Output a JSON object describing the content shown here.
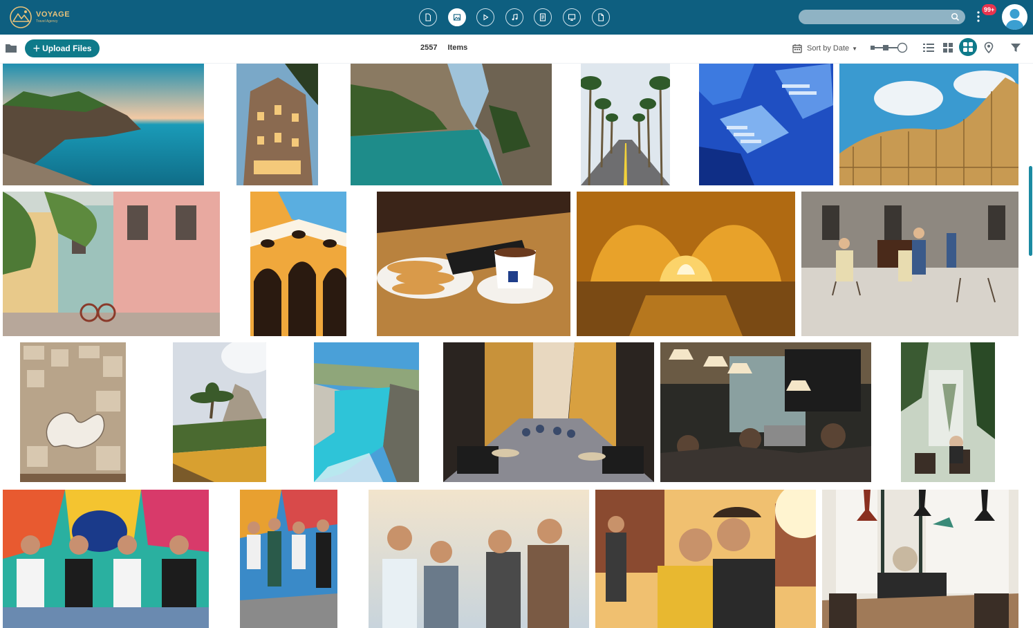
{
  "header": {
    "brand": {
      "name": "VOYAGE",
      "tagline": "Travel Agency"
    },
    "type_tabs": [
      {
        "name": "documents",
        "icon": "document-icon"
      },
      {
        "name": "images",
        "icon": "image-icon",
        "active": true
      },
      {
        "name": "videos",
        "icon": "play-icon"
      },
      {
        "name": "audio",
        "icon": "music-note-icon"
      },
      {
        "name": "text",
        "icon": "text-file-icon"
      },
      {
        "name": "presentations",
        "icon": "presentation-icon"
      },
      {
        "name": "other",
        "icon": "file-icon"
      }
    ],
    "search": {
      "placeholder": "",
      "icon": "search-icon"
    },
    "notifications": {
      "badge": "99+"
    },
    "colors": {
      "bar": "#0e5f80",
      "badge": "#e8344e"
    }
  },
  "toolbar": {
    "upload_label": "Upload Files",
    "item_count": "2557",
    "items_label": "Items",
    "sort_label": "Sort by Date",
    "views": [
      "list-view-icon",
      "grid-view-icon",
      "mosaic-view-icon",
      "map-pin-icon",
      "filter-icon"
    ],
    "active_view": "mosaic-view-icon",
    "accent": "#0e7a8a"
  },
  "gallery": {
    "photos": [
      {
        "name": "photo-coastal-cliffs"
      },
      {
        "name": "photo-casa-batllo"
      },
      {
        "name": "photo-river-canyon"
      },
      {
        "name": "photo-palm-boulevard"
      },
      {
        "name": "photo-blue-staircases"
      },
      {
        "name": "photo-metropol-parasol"
      },
      {
        "name": "photo-colorful-street"
      },
      {
        "name": "photo-courtyard-arches"
      },
      {
        "name": "photo-churros-chocolate"
      },
      {
        "name": "photo-golden-arched-baths"
      },
      {
        "name": "photo-street-musicians"
      },
      {
        "name": "photo-aerial-city"
      },
      {
        "name": "photo-palm-terrace"
      },
      {
        "name": "photo-turquoise-cove"
      },
      {
        "name": "photo-busy-cafe-street"
      },
      {
        "name": "photo-coffee-shop-interior"
      },
      {
        "name": "photo-garden-cafe"
      },
      {
        "name": "photo-mural-friends"
      },
      {
        "name": "photo-mural-group"
      },
      {
        "name": "photo-sunset-friends"
      },
      {
        "name": "photo-rooftop-couple"
      },
      {
        "name": "photo-cafe-window"
      }
    ]
  }
}
